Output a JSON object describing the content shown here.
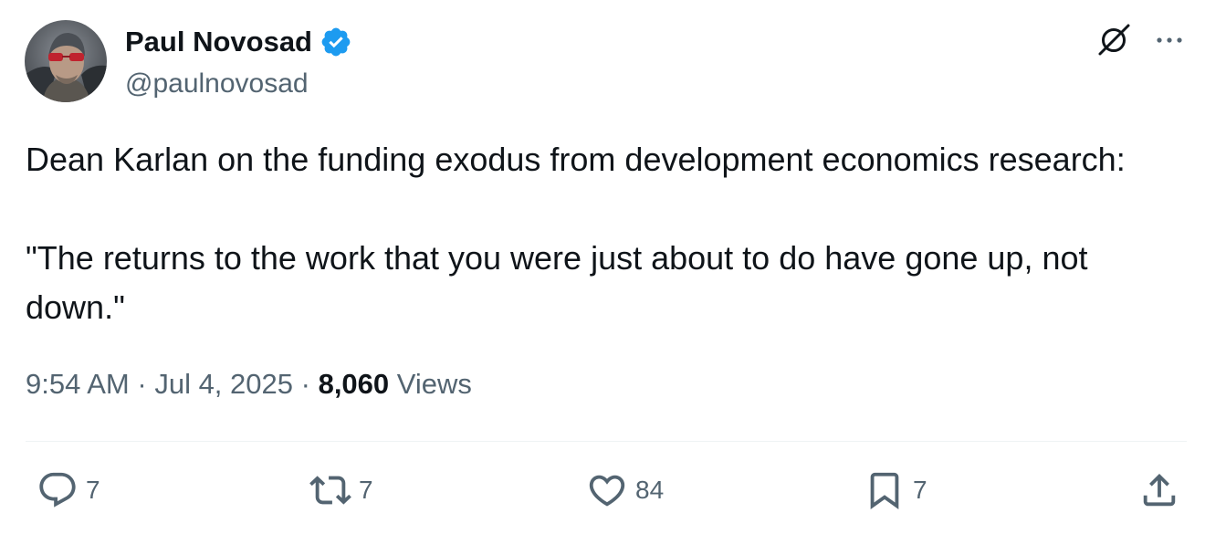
{
  "author": {
    "display_name": "Paul Novosad",
    "handle": "@paulnovosad",
    "verified_icon": "verified-badge-icon",
    "verified_color": "#1d9bf0",
    "avatar_icon": "profile-photo"
  },
  "top_actions": {
    "grok_icon": "grok-icon",
    "more_icon": "more-options-icon"
  },
  "tweet": {
    "text": "Dean Karlan on the funding exodus from development economics research:\n\n\"The returns to the work that you were just about to do have gone up, not down.\""
  },
  "meta": {
    "time": "9:54 AM",
    "separator": "·",
    "date": "Jul 4, 2025",
    "views_count": "8,060",
    "views_label": "Views"
  },
  "actions": {
    "replies": "7",
    "reposts": "7",
    "likes": "84",
    "bookmarks": "7"
  },
  "colors": {
    "text_primary": "#0f1419",
    "text_secondary": "#536471",
    "divider": "#eff3f4"
  }
}
